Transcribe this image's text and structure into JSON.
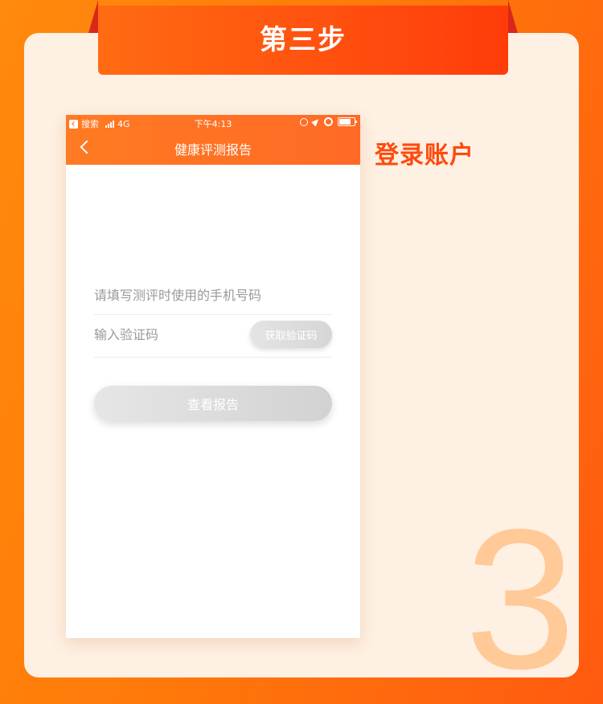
{
  "banner": {
    "title": "第三步"
  },
  "step": {
    "label": "登录账户",
    "number": "3"
  },
  "phone": {
    "status_bar": {
      "back_app": "搜索",
      "network": "4G",
      "time": "下午4:13"
    },
    "nav": {
      "title": "健康评测报告"
    },
    "form": {
      "phone_placeholder": "请填写测评时使用的手机号码",
      "code_placeholder": "输入验证码",
      "get_code_label": "获取验证码",
      "submit_label": "查看报告"
    }
  },
  "colors": {
    "accent": "#ff4a0e",
    "header": "#ff6a26",
    "card_bg": "#fef0e2",
    "number": "#ffc998"
  }
}
